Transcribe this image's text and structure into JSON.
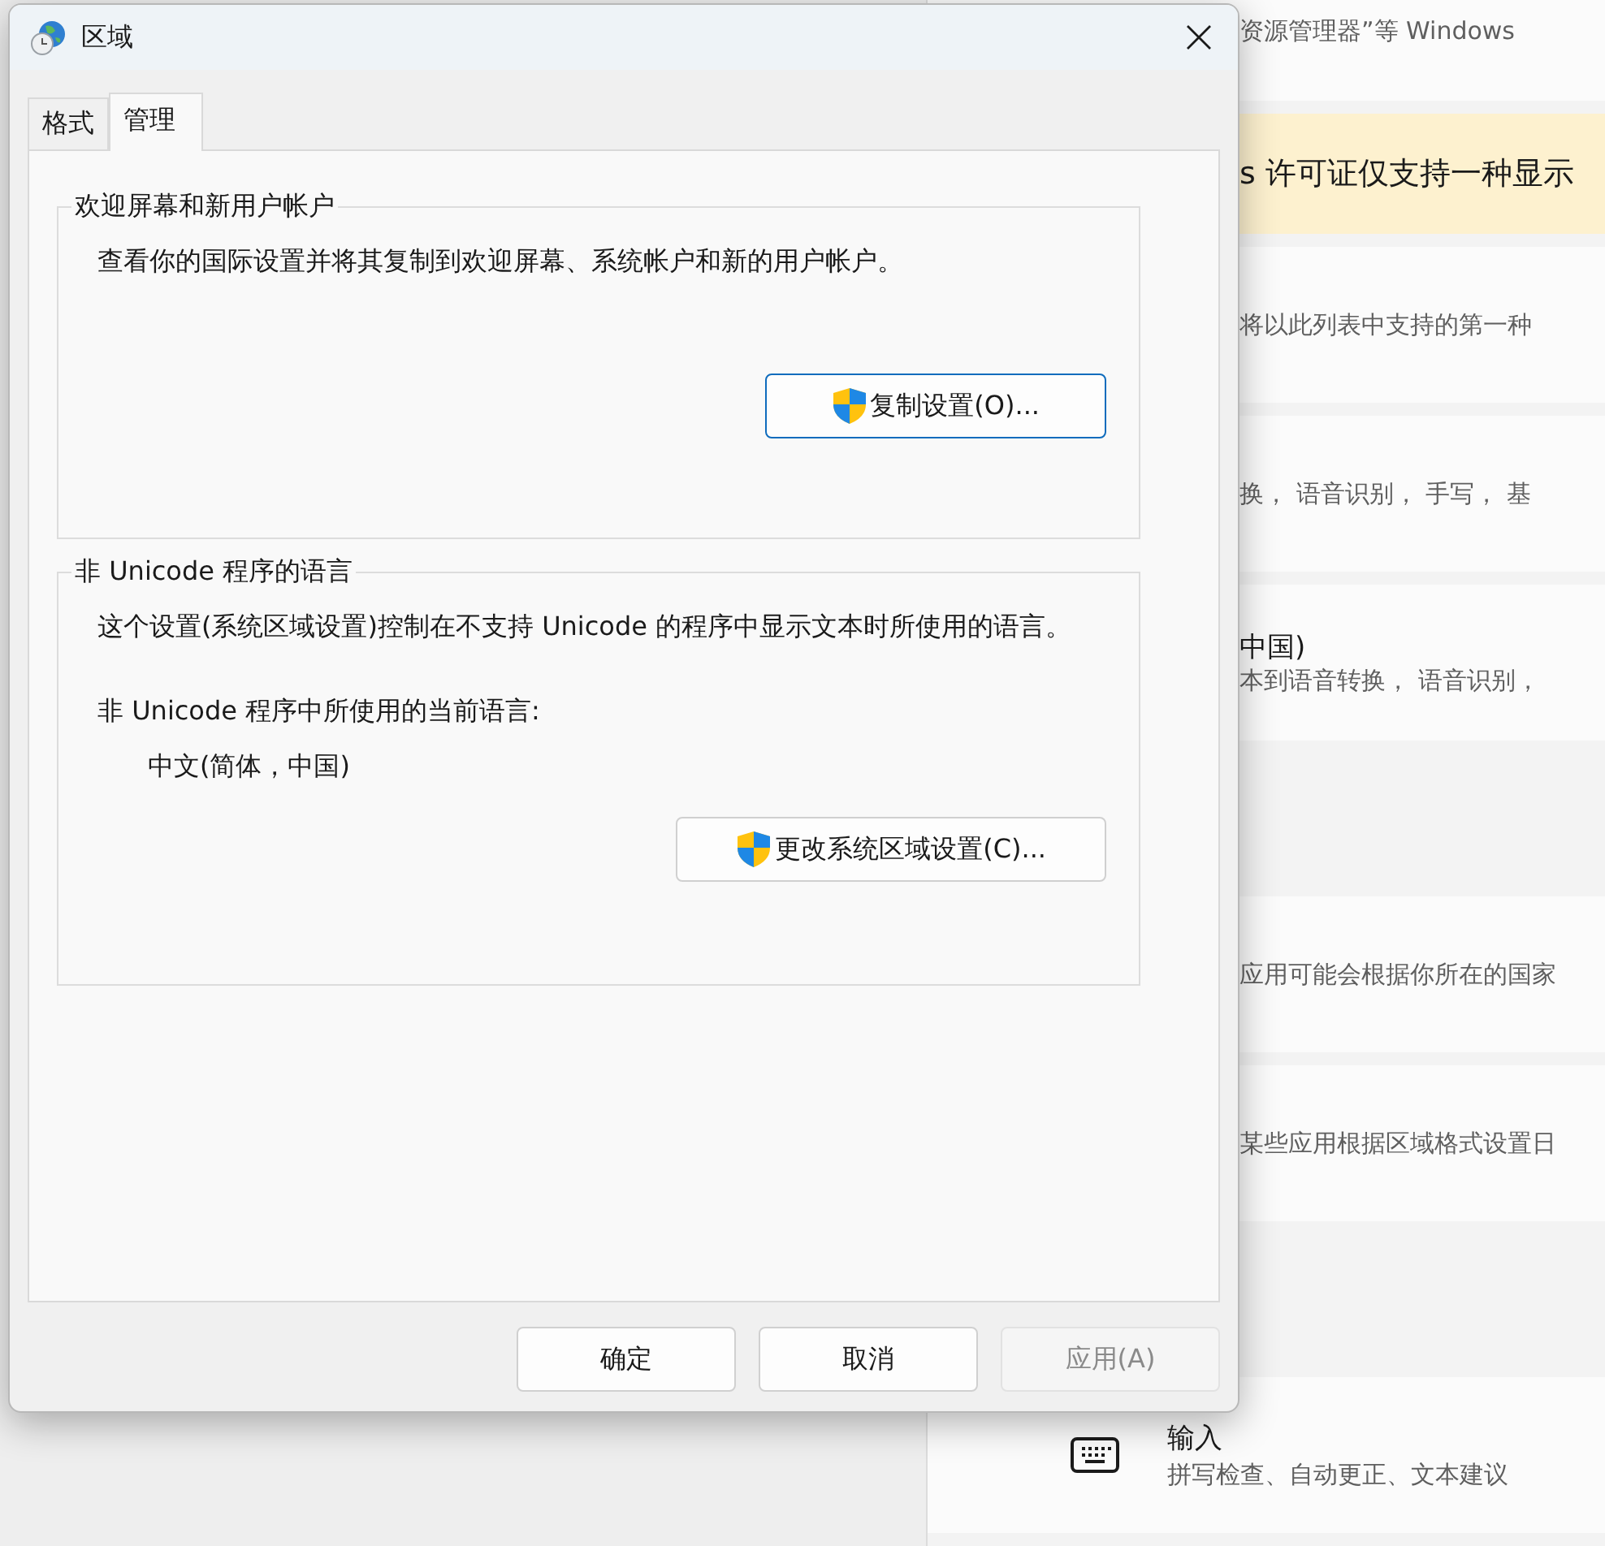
{
  "settings": {
    "rows": [
      {
        "kind": "plain",
        "description": "资源管理器”等 Windows"
      },
      {
        "kind": "warning",
        "description": "s 许可证仅支持一种显示"
      },
      {
        "kind": "plain",
        "description": "将以此列表中支持的第一种"
      },
      {
        "kind": "plain",
        "description": "换， 语音识别， 手写， 基"
      },
      {
        "kind": "titled",
        "title": "中国)",
        "description": "本到语音转换， 语音识别，"
      },
      {
        "kind": "empty"
      },
      {
        "kind": "plain",
        "description": "应用可能会根据你所在的国家"
      },
      {
        "kind": "plain",
        "description": "某些应用根据区域格式设置日"
      },
      {
        "kind": "empty"
      },
      {
        "kind": "icon",
        "title": "输入",
        "description": "拼写检查、自动更正、文本建议"
      }
    ]
  },
  "dialog": {
    "title": "区域",
    "tabs": [
      {
        "label": "格式",
        "selected": false
      },
      {
        "label": "管理",
        "selected": true
      }
    ],
    "groups": [
      {
        "legend": "欢迎屏幕和新用户帐户",
        "items": [
          {
            "kind": "text",
            "text": "查看你的国际设置并将其复制到欢迎屏幕、系统帐户和新的用户帐户。"
          }
        ],
        "button": {
          "label": "复制设置(O)...",
          "focused": true
        }
      },
      {
        "legend": "非 Unicode 程序的语言",
        "items": [
          {
            "kind": "text",
            "text": "这个设置(系统区域设置)控制在不支持 Unicode 的程序中显示文本时所使用的语言。"
          },
          {
            "kind": "text",
            "text": "非 Unicode 程序中所使用的当前语言:"
          },
          {
            "kind": "indented",
            "text": "中文(简体，中国)"
          }
        ],
        "button": {
          "label": "更改系统区域设置(C)...",
          "focused": false
        }
      }
    ],
    "buttons": [
      {
        "label": "确定",
        "disabled": false
      },
      {
        "label": "取消",
        "disabled": false
      },
      {
        "label": "应用(A)",
        "disabled": true
      }
    ]
  }
}
